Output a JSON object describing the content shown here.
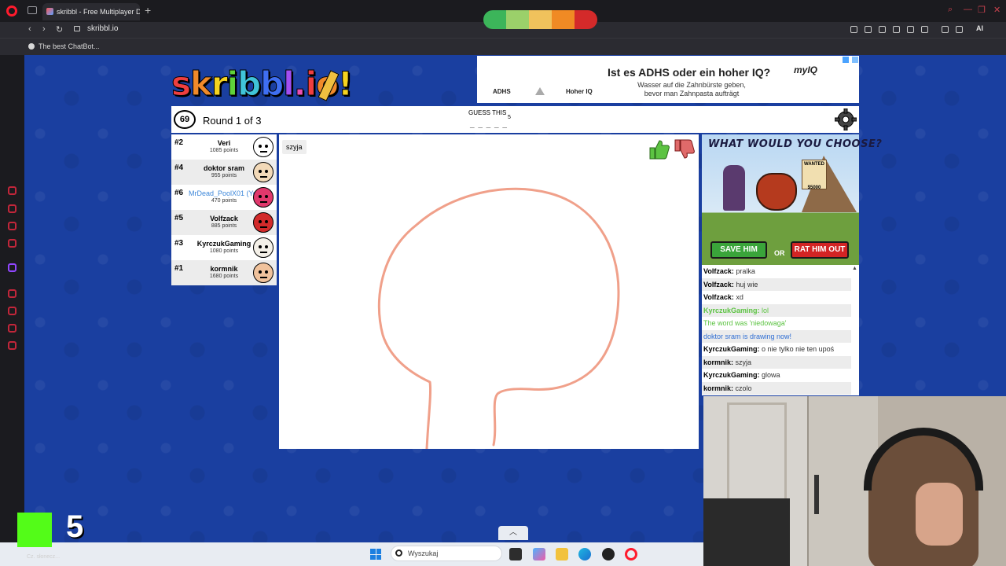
{
  "browser": {
    "tab_title": "skribbl - Free Multiplayer D",
    "url": "skribbl.io",
    "bookmark": "The best ChatBot...",
    "ai_label": "AI"
  },
  "logo": {
    "text": "skribbl.io"
  },
  "top_ad": {
    "label_left": "ADHS",
    "label_right": "Hoher IQ",
    "headline": "Ist es ADHS oder ein hoher IQ?",
    "subtext": "Wasser auf die Zahnbürste geben, bevor man Zahnpasta aufträgt",
    "brand": "myIQ",
    "scale_colors": [
      "#3cb55a",
      "#9bd06a",
      "#f0c25c",
      "#f08a24",
      "#d42a2a"
    ]
  },
  "game": {
    "timer": "69",
    "round": "Round 1 of 3",
    "guess_label": "GUESS THIS",
    "guess_length": "5",
    "guess_blanks": "_ _ _ _ _",
    "word_hint": "szyja"
  },
  "players": [
    {
      "rank": "#2",
      "name": "Veri",
      "points": "1085 points",
      "avatar_color": "#ffffff",
      "me": false
    },
    {
      "rank": "#4",
      "name": "doktor sram",
      "points": "955 points",
      "avatar_color": "#f2d9b8",
      "me": false
    },
    {
      "rank": "#6",
      "name": "MrDead_PoolX01 (You)",
      "points": "470 points",
      "avatar_color": "#e0386c",
      "me": true
    },
    {
      "rank": "#5",
      "name": "Volfzack",
      "points": "885 points",
      "avatar_color": "#d22a2a",
      "me": false
    },
    {
      "rank": "#3",
      "name": "KyrczukGaming",
      "points": "1080 points",
      "avatar_color": "#f4f0e8",
      "me": false
    },
    {
      "rank": "#1",
      "name": "kormnik",
      "points": "1680 points",
      "avatar_color": "#f0c29c",
      "me": false
    }
  ],
  "side_ad": {
    "title": "WHAT WOULD YOU CHOOSE?",
    "wanted": "WANTED",
    "reward": "$5000",
    "save_label": "SAVE HIM",
    "or_label": "OR",
    "rat_label": "RAT HIM OUT"
  },
  "chat": [
    {
      "user": "Volfzack:",
      "text": "pralka",
      "style": ""
    },
    {
      "user": "Volfzack:",
      "text": "huj wie",
      "style": ""
    },
    {
      "user": "Volfzack:",
      "text": "xd",
      "style": ""
    },
    {
      "user": "KyrczukGaming:",
      "text": "lol",
      "style": "green"
    },
    {
      "user": "",
      "text": "The word was 'niedowaga'",
      "style": "green"
    },
    {
      "user": "",
      "text": "doktor sram is drawing now!",
      "style": "blue"
    },
    {
      "user": "KyrczukGaming:",
      "text": "o nie tylko nie ten upoś",
      "style": ""
    },
    {
      "user": "kormnik:",
      "text": "szyja",
      "style": ""
    },
    {
      "user": "KyrczukGaming:",
      "text": "glowa",
      "style": ""
    },
    {
      "user": "kormnik:",
      "text": "czolo",
      "style": ""
    }
  ],
  "overlay": {
    "kick_count": "5",
    "caption": "Cz. słonecz..."
  },
  "taskbar": {
    "search_placeholder": "Wyszukaj"
  }
}
